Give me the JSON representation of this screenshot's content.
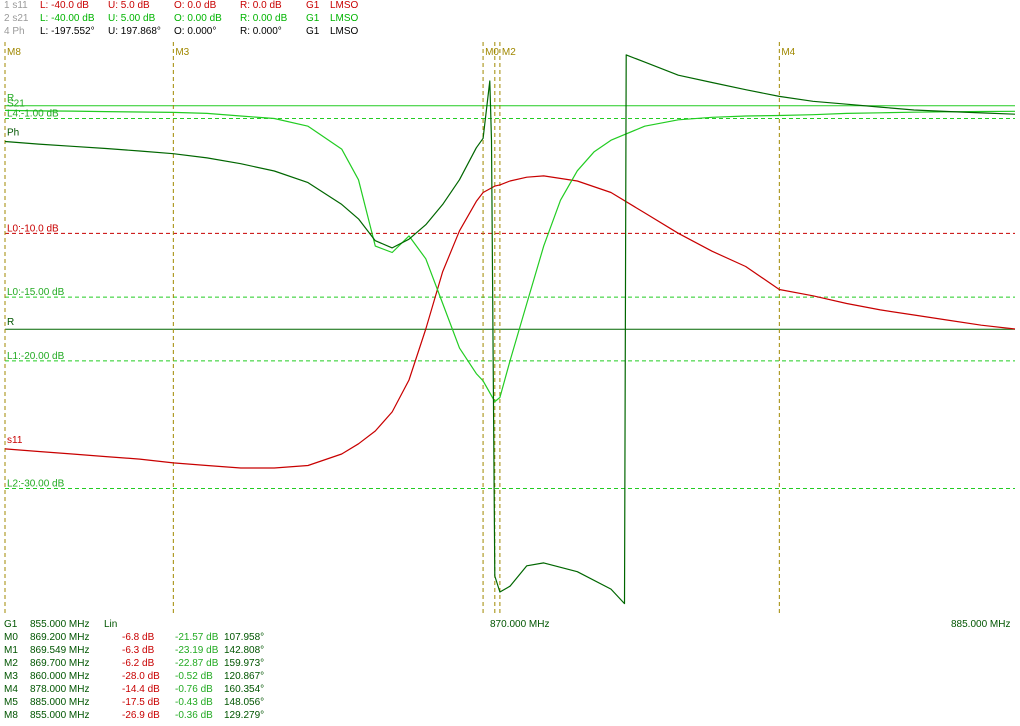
{
  "header": [
    {
      "name": "1 s11",
      "low": "L: -40.0 dB",
      "up": "U:  5.0 dB",
      "off": "O:  0.0 dB",
      "ref": "R:  0.0 dB",
      "gen": "G1",
      "mode": "LMSO",
      "color": "#c80000"
    },
    {
      "name": "2 s21",
      "low": "L: -40.00 dB",
      "up": "U:  5.00 dB",
      "off": "O:  0.00 dB",
      "ref": "R:  0.00 dB",
      "gen": "G1",
      "mode": "LMSO",
      "color": "#00b400"
    },
    {
      "name": "4 Ph",
      "low": "L: -197.552°",
      "up": "U:  197.868°",
      "off": "O:  0.000°",
      "ref": "R:  0.000°",
      "gen": "G1",
      "mode": "LMSO",
      "color": "#000000"
    }
  ],
  "axis": {
    "gen": "G1",
    "start": "855.000 MHz",
    "scale": "Lin",
    "center": "870.000 MHz",
    "stop": "885.000 MHz"
  },
  "markers_table": [
    {
      "name": "M0",
      "freq": "869.200 MHz",
      "s11": "-6.8 dB",
      "s21": "-21.57 dB",
      "ph": "107.958°"
    },
    {
      "name": "M1",
      "freq": "869.549 MHz",
      "s11": "-6.3 dB",
      "s21": "-23.19 dB",
      "ph": "142.808°"
    },
    {
      "name": "M2",
      "freq": "869.700 MHz",
      "s11": "-6.2 dB",
      "s21": "-22.87 dB",
      "ph": "159.973°"
    },
    {
      "name": "M3",
      "freq": "860.000 MHz",
      "s11": "-28.0 dB",
      "s21": "-0.52 dB",
      "ph": "120.867°"
    },
    {
      "name": "M4",
      "freq": "878.000 MHz",
      "s11": "-14.4 dB",
      "s21": "-0.76 dB",
      "ph": "160.354°"
    },
    {
      "name": "M5",
      "freq": "885.000 MHz",
      "s11": "-17.5 dB",
      "s21": "-0.43 dB",
      "ph": "148.056°"
    },
    {
      "name": "M8",
      "freq": "855.000 MHz",
      "s11": "-26.9 dB",
      "s21": "-0.36 dB",
      "ph": "129.279°"
    }
  ],
  "colors": {
    "s11": "#c80000",
    "s21": "#22cc22",
    "phase": "#006600",
    "marker": "#a08800",
    "header_name": "#9a9a9a",
    "label_green": "#22aa22",
    "label_red": "#c80000",
    "label_dark": "#005500"
  },
  "chart_data": {
    "type": "line",
    "x_unit": "MHz",
    "xlim": [
      855,
      885
    ],
    "trace_labels": {
      "s11": "s11",
      "s21": "S21",
      "phase": "Ph",
      "ref_s21": "R",
      "ref_phase": "R"
    },
    "marker_lines": [
      {
        "name": "M8",
        "x": 855.0
      },
      {
        "name": "M3",
        "x": 860.0
      },
      {
        "name": "M0",
        "x": 869.2
      },
      {
        "name": "M1",
        "x": 869.549
      },
      {
        "name": "M2",
        "x": 869.7
      },
      {
        "name": "M4",
        "x": 878.0
      }
    ],
    "marker_labels": [
      {
        "text": "M8",
        "x": 855.0
      },
      {
        "text": "M3",
        "x": 860.0
      },
      {
        "text": "M0",
        "x": 869.2
      },
      {
        "text": "M2",
        "x": 869.7
      },
      {
        "text": "M4",
        "x": 878.0
      }
    ],
    "limit_lines": [
      {
        "label": "L4:-1.00 dB",
        "trace": "s21",
        "y_db": -1.0
      },
      {
        "label": "L0:-10.0 dB",
        "trace": "s11",
        "y_db": -10.0
      },
      {
        "label": "L0:-15.00 dB",
        "trace": "s21",
        "y_db": -15.0
      },
      {
        "label": "L1:-20.00 dB",
        "trace": "s21",
        "y_db": -20.0
      },
      {
        "label": "L2:-30.00 dB",
        "trace": "s21",
        "y_db": -30.0
      }
    ],
    "reference_lines": [
      {
        "trace": "s21",
        "y_db": 0.0
      },
      {
        "trace": "phase",
        "y_deg": 0.0
      }
    ],
    "y_scale": {
      "s11_db": [
        -40,
        5
      ],
      "s21_db": [
        -40,
        5
      ],
      "phase_deg": [
        -197.552,
        197.868
      ]
    },
    "series": [
      {
        "name": "s11",
        "unit": "dB",
        "x": [
          855,
          856,
          857,
          858,
          859,
          860,
          861,
          862,
          863,
          864,
          865,
          865.5,
          866,
          866.5,
          867,
          867.5,
          868,
          868.5,
          869,
          869.2,
          869.549,
          869.7,
          870,
          870.5,
          871,
          872,
          873,
          874,
          875,
          876,
          877,
          878,
          879,
          880,
          881,
          882,
          883,
          884,
          885
        ],
        "y": [
          -26.9,
          -27.1,
          -27.3,
          -27.5,
          -27.7,
          -28.0,
          -28.2,
          -28.4,
          -28.4,
          -28.2,
          -27.3,
          -26.5,
          -25.5,
          -24.0,
          -21.5,
          -17.5,
          -13.0,
          -9.8,
          -7.5,
          -6.8,
          -6.3,
          -6.2,
          -5.9,
          -5.6,
          -5.5,
          -5.9,
          -6.8,
          -8.4,
          -10.0,
          -11.4,
          -12.6,
          -14.4,
          -14.9,
          -15.5,
          -16.0,
          -16.4,
          -16.8,
          -17.2,
          -17.5
        ]
      },
      {
        "name": "s21",
        "unit": "dB",
        "x": [
          855,
          856,
          857,
          858,
          859,
          860,
          861,
          862,
          863,
          864,
          865,
          865.5,
          866,
          866.5,
          867,
          867.5,
          868,
          868.5,
          869,
          869.2,
          869.549,
          869.7,
          870,
          870.5,
          871,
          871.5,
          872,
          872.5,
          873,
          874,
          875,
          876,
          877,
          878,
          879,
          880,
          881,
          882,
          883,
          884,
          885
        ],
        "y": [
          -0.36,
          -0.4,
          -0.42,
          -0.46,
          -0.49,
          -0.52,
          -0.6,
          -0.8,
          -1.0,
          -1.6,
          -3.4,
          -5.8,
          -11.0,
          -11.5,
          -10.2,
          -12.0,
          -15.5,
          -19.0,
          -21.0,
          -21.57,
          -23.19,
          -22.87,
          -20.0,
          -15.5,
          -11.0,
          -7.4,
          -5.1,
          -3.6,
          -2.7,
          -1.6,
          -1.1,
          -0.9,
          -0.8,
          -0.76,
          -0.7,
          -0.6,
          -0.55,
          -0.5,
          -0.47,
          -0.45,
          -0.43
        ]
      },
      {
        "name": "Ph",
        "unit": "deg",
        "x": [
          855,
          856,
          857,
          858,
          859,
          860,
          861,
          862,
          863,
          864,
          865,
          865.5,
          866,
          866.5,
          867,
          867.5,
          868,
          868.5,
          869,
          869.2,
          869.4,
          869.45,
          869.55,
          869.7,
          870,
          870.5,
          871,
          872,
          873,
          873.4,
          873.45,
          874,
          875,
          876,
          877,
          878,
          879,
          880,
          881,
          882,
          883,
          884,
          885
        ],
        "y": [
          129.3,
          127.5,
          126,
          124.5,
          122.8,
          120.9,
          118,
          114,
          109,
          101,
          86,
          76,
          61,
          56,
          62,
          72,
          86,
          103,
          125,
          131.5,
          171,
          130,
          -170,
          -181,
          -177,
          -163,
          -161,
          -167,
          -179,
          -189,
          189,
          184,
          175,
          170,
          165,
          160.4,
          157,
          155,
          153,
          151,
          150,
          149,
          148.1
        ]
      }
    ]
  }
}
